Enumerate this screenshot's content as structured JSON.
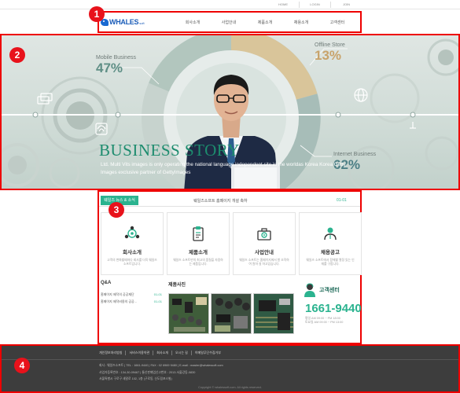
{
  "util_links": [
    "HOME",
    "LOGIN",
    "JOIN"
  ],
  "logo": {
    "name": "WHALES",
    "suffix": "soft"
  },
  "nav": [
    "회사소개",
    "사업안내",
    "제품소개",
    "채용소개",
    "고객센터"
  ],
  "badges": [
    "1",
    "2",
    "3",
    "4"
  ],
  "hero": {
    "title": "BUSINESS STORY",
    "desc": "Ltd. Multi Vits images is only operating the national language independent site in the worldas Korea Korea Getty Images exclusive partner of GettyImages",
    "stats": [
      {
        "label": "Mobile Business",
        "value": "47%",
        "color": "#5f8f86"
      },
      {
        "label": "Offline Store",
        "value": "13%",
        "color": "#c8a36b"
      },
      {
        "label": "Internet Business",
        "value": "62%",
        "color": "#4c7f85"
      }
    ]
  },
  "notice": {
    "tag": "웨일즈 뉴스 & 소식",
    "message": "웨일즈소프트 홈페이지 개설 축하",
    "date": "01-01"
  },
  "cards": [
    {
      "title": "회사소개",
      "desc": "고객의 변화할때마다 회사를 더욱 웨일즈 소프트입니다."
    },
    {
      "title": "제품소개",
      "desc": "웨일즈 소프트만의 최고의 품질을 자랑하는 제품입니다."
    },
    {
      "title": "사업안내",
      "desc": "웨일즈 소프트는 홈페이지에서 항 조작하여 원하 실 하고있습니다."
    },
    {
      "title": "채용공고",
      "desc": "웨일즈 소프트에서 함께할 열정 있는 인재를 구합니다."
    }
  ],
  "qna": {
    "title": "Q&A",
    "items": [
      {
        "text": "홈페이지 제작의 공공재단",
        "date": "01-01"
      },
      {
        "text": "홈페이지 제작비용의 공공...",
        "date": "01-01"
      }
    ]
  },
  "photos": {
    "title": "제품사진"
  },
  "cs": {
    "title": "고객센터",
    "tel": "1661-9440",
    "hours": [
      "평일 AM 09:00 ~ PM 18:00",
      "토요일 AM 09:00 ~ PM 13:00"
    ]
  },
  "footer": {
    "links": [
      "개인정보처리방침",
      "서비스이용약관",
      "회사소개",
      "오시는 길",
      "이메일무단수집거부"
    ],
    "info": [
      "회사 : 웨일즈소프트 | TEL : 1661-9440 | FAX : 02 6969 9480 | E-mail : master@whalessoft.com",
      "사업자등록번호 : 134-30-09467 | 통신판매업신고번호 : 2013-서울강동-0830",
      "서울특별시 구로구 새말로 102, 1층 (구로동, 신도림포스빌)"
    ],
    "copyright": "Copyright © whalessoft.com. All rights reserved."
  }
}
